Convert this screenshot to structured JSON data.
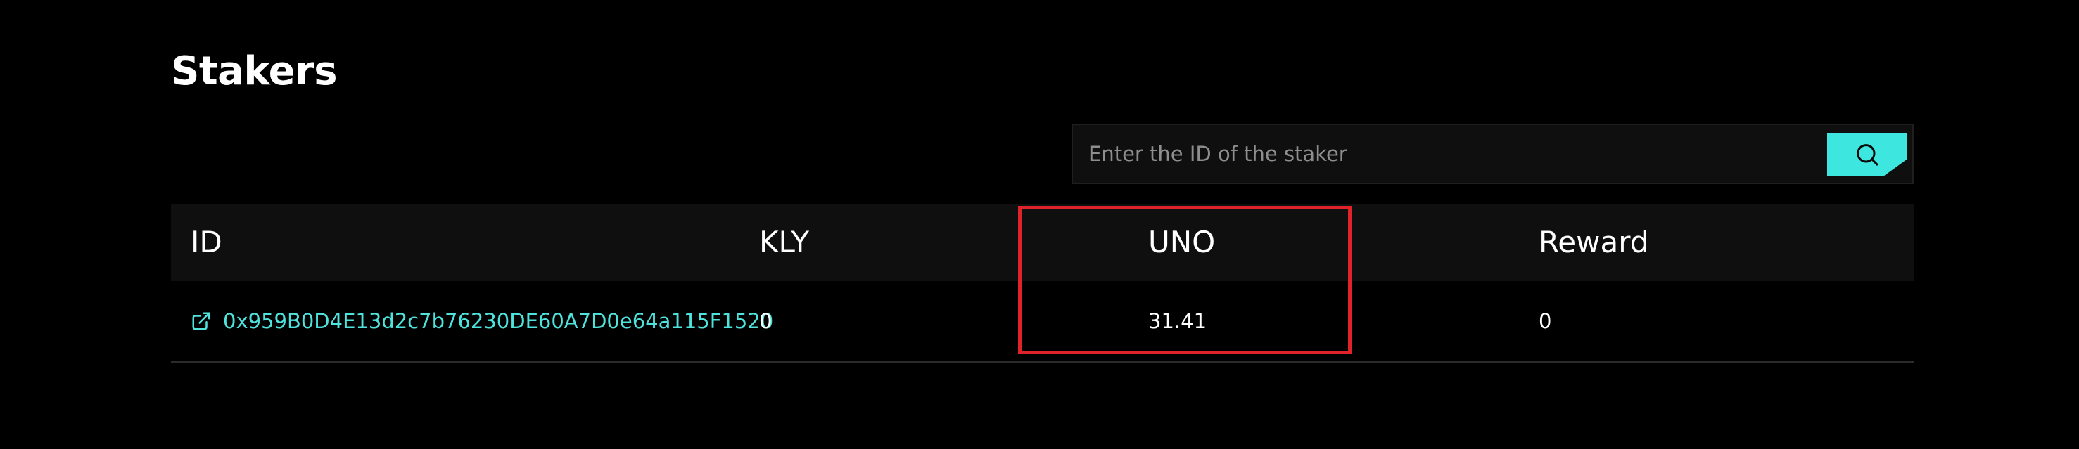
{
  "page": {
    "title": "Stakers"
  },
  "search": {
    "placeholder": "Enter the ID of the staker",
    "value": ""
  },
  "table": {
    "headers": [
      "ID",
      "KLY",
      "UNO",
      "Reward"
    ],
    "rows": [
      {
        "id": "0x959B0D4E13d2c7b76230DE60A7D0e64a115F1520",
        "kly": "0",
        "uno": "31.41",
        "reward": "0"
      }
    ]
  },
  "colors": {
    "accent": "#3ee6e0",
    "link": "#4fe3dd",
    "highlight": "#e0232b",
    "background": "#000000"
  },
  "icons": {
    "search": "search-icon",
    "link": "external-link-icon"
  }
}
